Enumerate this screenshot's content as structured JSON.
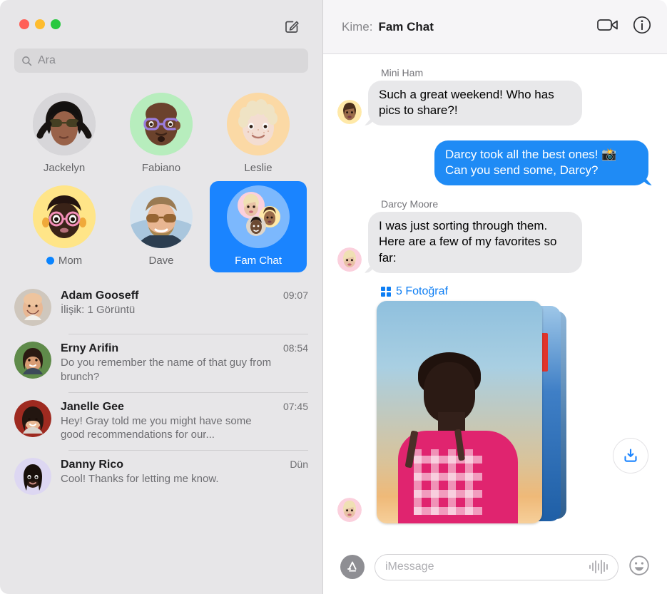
{
  "window": {
    "traffic_lights": [
      "close",
      "minimize",
      "zoom"
    ],
    "compose_icon": "compose-icon"
  },
  "search": {
    "placeholder": "Ara",
    "icon": "search-icon"
  },
  "pinned": [
    {
      "name": "Jackelyn",
      "type": "photo",
      "unread": false
    },
    {
      "name": "Fabiano",
      "type": "memoji",
      "bg": "#b7edbd",
      "unread": false
    },
    {
      "name": "Leslie",
      "type": "memoji",
      "bg": "#fbd9a5",
      "unread": false
    },
    {
      "name": "Mom",
      "type": "memoji",
      "bg": "#ffe588",
      "unread": true
    },
    {
      "name": "Dave",
      "type": "photo",
      "unread": false
    },
    {
      "name": "Fam Chat",
      "type": "group",
      "bg": "#1a84ff",
      "unread": false,
      "selected": true
    }
  ],
  "conversations": [
    {
      "name": "Adam Gooseff",
      "time": "09:07",
      "preview": "İlişik: 1 Görüntü"
    },
    {
      "name": "Erny Arifin",
      "time": "08:54",
      "preview": "Do you remember the name of that guy from brunch?"
    },
    {
      "name": "Janelle Gee",
      "time": "07:45",
      "preview": "Hey! Gray told me you might have some good recommendations for our..."
    },
    {
      "name": "Danny Rico",
      "time": "Dün",
      "preview": "Cool! Thanks for letting me know."
    }
  ],
  "chat_header": {
    "to_label": "Kime:",
    "title": "Fam Chat",
    "facetime_icon": "video-camera-icon",
    "info_icon": "info-icon"
  },
  "messages": [
    {
      "sender": "Mini Ham",
      "direction": "in",
      "text": "Such a great weekend! Who has pics to share?!",
      "avatar_bg": "#ffe9a8"
    },
    {
      "sender": "",
      "direction": "out",
      "text": "Darcy took all the best ones! 📸 Can you send some, Darcy?"
    },
    {
      "sender": "Darcy Moore",
      "direction": "in",
      "text": "I was just sorting through them. Here are a few of my favorites so far:",
      "avatar_bg": "#fbd0dd"
    }
  ],
  "attachment": {
    "label": "5 Fotoğraf",
    "grid_icon": "grid-icon",
    "photo_count": 5,
    "save_icon": "download-icon"
  },
  "composer": {
    "app_icon": "app-store-icon",
    "placeholder": "iMessage",
    "audio_icon": "audio-waveform-icon",
    "emoji_icon": "smiley-face-icon"
  },
  "colors": {
    "accent_blue": "#1a84ff",
    "bubble_out": "#1f8bf5",
    "bubble_in": "#e8e8ea",
    "sidebar_bg": "#e7e6e8",
    "link_blue": "#0d7ef4"
  }
}
